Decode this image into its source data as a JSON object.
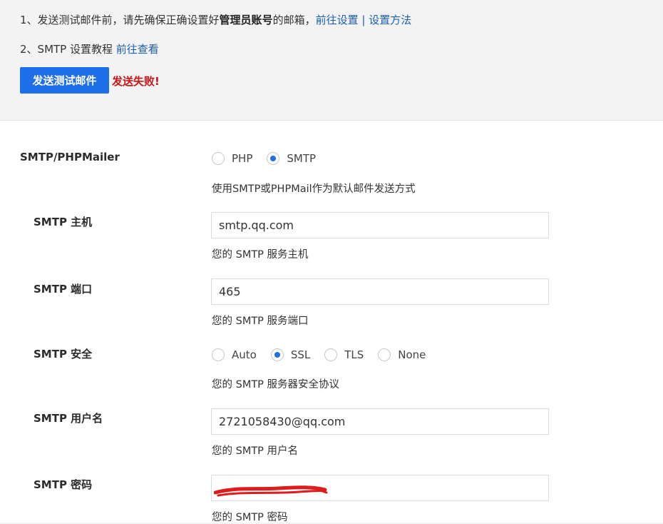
{
  "notes": {
    "line1_prefix": "1、发送测试邮件前，请先确保正确设置好",
    "line1_bold": "管理员账号",
    "line1_suffix": "的邮箱，",
    "line1_link_settings": "前往设置",
    "line1_separator": "|",
    "line1_link_method": "设置方法",
    "line2_prefix": "2、SMTP 设置教程",
    "line2_link": "前往查看"
  },
  "test": {
    "button_label": "发送测试邮件",
    "result_text": "发送失败!"
  },
  "form": {
    "mailer": {
      "label": "SMTP/PHPMailer",
      "options": [
        "PHP",
        "SMTP"
      ],
      "selected": "SMTP",
      "description": "使用SMTP或PHPMail作为默认邮件发送方式"
    },
    "host": {
      "label": "SMTP 主机",
      "value": "smtp.qq.com",
      "description": "您的 SMTP 服务主机"
    },
    "port": {
      "label": "SMTP 端口",
      "value": "465",
      "description": "您的 SMTP 服务端口"
    },
    "security": {
      "label": "SMTP 安全",
      "options": [
        "Auto",
        "SSL",
        "TLS",
        "None"
      ],
      "selected": "SSL",
      "description": "您的 SMTP 服务器安全协议"
    },
    "username": {
      "label": "SMTP 用户名",
      "value": "2721058430@qq.com",
      "description": "您的 SMTP 用户名"
    },
    "password": {
      "label": "SMTP 密码",
      "value": "",
      "description": "您的 SMTP 密码"
    }
  },
  "colors": {
    "accent": "#1f6fea",
    "error": "#c81414",
    "link": "#1a5fb4",
    "redaction": "#e01b1b"
  }
}
